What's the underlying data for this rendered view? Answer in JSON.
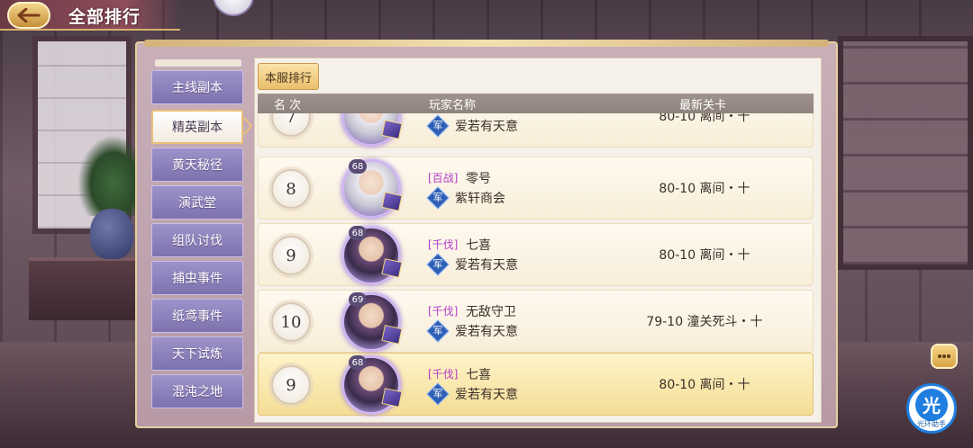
{
  "header": {
    "title": "全部排行"
  },
  "sidebar": {
    "items": [
      {
        "label": "主线副本",
        "active": false
      },
      {
        "label": "精英副本",
        "active": true
      },
      {
        "label": "黄天秘径",
        "active": false
      },
      {
        "label": "演武堂",
        "active": false
      },
      {
        "label": "组队讨伐",
        "active": false
      },
      {
        "label": "捕虫事件",
        "active": false
      },
      {
        "label": "纸鸢事件",
        "active": false
      },
      {
        "label": "天下试炼",
        "active": false
      },
      {
        "label": "混沌之地",
        "active": false
      }
    ]
  },
  "tab": {
    "label": "本服排行"
  },
  "columns": {
    "rank": "名 次",
    "player": "玩家名称",
    "stage": "最新关卡"
  },
  "rows": [
    {
      "rank": "7",
      "level": "",
      "tag": "",
      "name": "",
      "guild_icon": "军",
      "guild": "爱若有天意",
      "stage": "80-10 离间・十",
      "avatar": "light"
    },
    {
      "rank": "8",
      "level": "68",
      "tag": "[百战]",
      "name": "零号",
      "guild_icon": "军",
      "guild": "紫轩商会",
      "stage": "80-10 离间・十",
      "avatar": "light"
    },
    {
      "rank": "9",
      "level": "68",
      "tag": "[千伐]",
      "name": "七喜",
      "guild_icon": "军",
      "guild": "爱若有天意",
      "stage": "80-10 离间・十",
      "avatar": "dark"
    },
    {
      "rank": "10",
      "level": "69",
      "tag": "[千伐]",
      "name": "无敌守卫",
      "guild_icon": "军",
      "guild": "爱若有天意",
      "stage": "79-10 潼关死斗・十",
      "avatar": "dark"
    },
    {
      "rank": "9",
      "level": "68",
      "tag": "[千伐]",
      "name": "七喜",
      "guild_icon": "军",
      "guild": "爱若有天意",
      "stage": "80-10 离间・十",
      "avatar": "dark",
      "highlight": true
    }
  ],
  "widgets": {
    "helper_char": "光",
    "helper_label": "光环助手"
  },
  "icons": {
    "back": "back-arrow-icon",
    "chat": "chat-bubble-icon",
    "guild": "guild-emblem-icon",
    "helper": "helper-logo-icon"
  }
}
